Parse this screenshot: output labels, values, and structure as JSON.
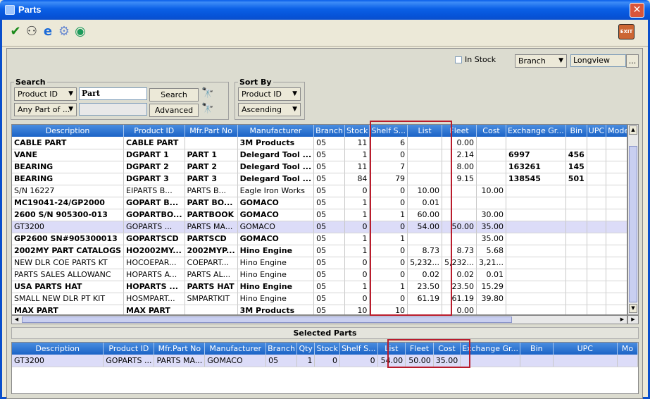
{
  "window": {
    "title": "Parts",
    "close_glyph": "✕"
  },
  "toolbar": {
    "buttons": [
      {
        "name": "check-icon",
        "glyph": "✔",
        "color": "#1a8a1a"
      },
      {
        "name": "group-icon",
        "glyph": "⚇",
        "color": "#333"
      },
      {
        "name": "browser-icon",
        "glyph": "e",
        "color": "#1a6ad8"
      },
      {
        "name": "gears-icon",
        "glyph": "⚙",
        "color": "#6a8ad0"
      },
      {
        "name": "globe-icon",
        "glyph": "◉",
        "color": "#1a9a5a"
      }
    ],
    "exit_label": "EXIT"
  },
  "filter": {
    "in_stock_label": "In Stock",
    "branch_label": "Branch",
    "branch_value": "Longview",
    "ellipsis": "..."
  },
  "search": {
    "title": "Search",
    "field_select": "Product ID",
    "query_value": "Part",
    "match_select": "Any Part of ...",
    "search_btn": "Search",
    "advanced_btn": "Advanced"
  },
  "sort": {
    "title": "Sort By",
    "field_select": "Product ID",
    "order_select": "Ascending"
  },
  "grid": {
    "columns": [
      "Description",
      "Product ID",
      "Mfr.Part No",
      "Manufacturer",
      "Branch",
      "Stock",
      "Shelf S...",
      "List",
      "Fleet",
      "Cost",
      "Exchange Gr...",
      "Bin",
      "UPC",
      "Mode"
    ],
    "rows": [
      {
        "bold": true,
        "cells": [
          "CABLE PART",
          "CABLE PART",
          "",
          "3M Products",
          "05",
          "11",
          "6",
          "",
          "0.00",
          "",
          "",
          "",
          "",
          ""
        ]
      },
      {
        "bold": true,
        "cells": [
          "VANE",
          "DGPART 1",
          "PART 1",
          "Delegard Tool ...",
          "05",
          "1",
          "0",
          "",
          "2.14",
          "",
          "6997",
          "456",
          "",
          ""
        ]
      },
      {
        "bold": true,
        "cells": [
          "BEARING",
          "DGPART 2",
          "PART 2",
          "Delegard Tool ...",
          "05",
          "11",
          "7",
          "",
          "8.00",
          "",
          "163261",
          "145",
          "",
          ""
        ]
      },
      {
        "bold": true,
        "cells": [
          "BEARING",
          "DGPART 3",
          "PART 3",
          "Delegard Tool ...",
          "05",
          "84",
          "79",
          "",
          "9.15",
          "",
          "138545",
          "501",
          "",
          ""
        ]
      },
      {
        "bold": false,
        "cells": [
          "S/N 16227",
          "EIPARTS B...",
          "PARTS B...",
          "Eagle Iron Works",
          "05",
          "0",
          "0",
          "10.00",
          "",
          "10.00",
          "",
          "",
          "",
          ""
        ]
      },
      {
        "bold": true,
        "cells": [
          "MC19041-24/GP2000",
          "GOPART B...",
          "PART BO...",
          "GOMACO",
          "05",
          "1",
          "0",
          "0.01",
          "",
          "",
          "",
          "",
          "",
          ""
        ]
      },
      {
        "bold": true,
        "cells": [
          "2600 S/N 905300-013",
          "GOPARTBO...",
          "PARTBOOK",
          "GOMACO",
          "05",
          "1",
          "1",
          "60.00",
          "",
          "30.00",
          "",
          "",
          "",
          ""
        ]
      },
      {
        "bold": false,
        "selected": true,
        "cells": [
          "GT3200",
          "GOPARTS ...",
          "PARTS MA...",
          "GOMACO",
          "05",
          "0",
          "0",
          "54.00",
          "50.00",
          "35.00",
          "",
          "",
          "",
          ""
        ]
      },
      {
        "bold": true,
        "cells": [
          "GP2600 SN#905300013",
          "GOPARTSCD",
          "PARTSCD",
          "GOMACO",
          "05",
          "1",
          "1",
          "",
          "",
          "35.00",
          "",
          "",
          "",
          ""
        ]
      },
      {
        "bold": true,
        "cells": [
          "2002MY PART CATALOGS",
          "HO2002MY...",
          "2002MYP...",
          "Hino Engine",
          "05",
          "1",
          "0",
          "8.73",
          "8.73",
          "5.68",
          "",
          "",
          "",
          ""
        ]
      },
      {
        "bold": false,
        "cells": [
          "NEW DLR COE PARTS KT",
          "HOCOEPAR...",
          "COEPART...",
          "Hino Engine",
          "05",
          "0",
          "0",
          "5,232...",
          "5,232...",
          "3,21...",
          "",
          "",
          "",
          ""
        ]
      },
      {
        "bold": false,
        "cells": [
          "PARTS SALES ALLOWANC",
          "HOPARTS A...",
          "PARTS AL...",
          "Hino Engine",
          "05",
          "0",
          "0",
          "0.02",
          "0.02",
          "0.01",
          "",
          "",
          "",
          ""
        ]
      },
      {
        "bold": true,
        "cells": [
          "USA PARTS HAT",
          "HOPARTS ...",
          "PARTS HAT",
          "Hino Engine",
          "05",
          "1",
          "1",
          "23.50",
          "23.50",
          "15.29",
          "",
          "",
          "",
          ""
        ]
      },
      {
        "bold": false,
        "cells": [
          "SMALL NEW DLR PT KIT",
          "HOSMPART...",
          "SMPARTKIT",
          "Hino Engine",
          "05",
          "0",
          "0",
          "61.19",
          "61.19",
          "39.80",
          "",
          "",
          "",
          ""
        ]
      },
      {
        "bold": true,
        "cells": [
          "MAX PART",
          "MAX PART",
          "",
          "3M Products",
          "05",
          "10",
          "10",
          "",
          "0.00",
          "",
          "",
          "",
          "",
          ""
        ]
      }
    ]
  },
  "selected": {
    "title": "Selected Parts",
    "columns": [
      "Description",
      "Product ID",
      "Mfr.Part No",
      "Manufacturer",
      "Branch",
      "Qty",
      "Stock",
      "Shelf S...",
      "List",
      "Fleet",
      "Cost",
      "Exchange Gr...",
      "Bin",
      "UPC",
      "Mo"
    ],
    "rows": [
      {
        "cells": [
          "GT3200",
          "GOPARTS ...",
          "PARTS MA...",
          "GOMACO",
          "05",
          "1",
          "0",
          "0",
          "54.00",
          "50.00",
          "35.00",
          "",
          "",
          "",
          ""
        ]
      }
    ]
  },
  "colors": {
    "highlight_box": "#b91c2c",
    "header_blue": "#1b63c6",
    "selected_row": "#dcdcf8"
  }
}
